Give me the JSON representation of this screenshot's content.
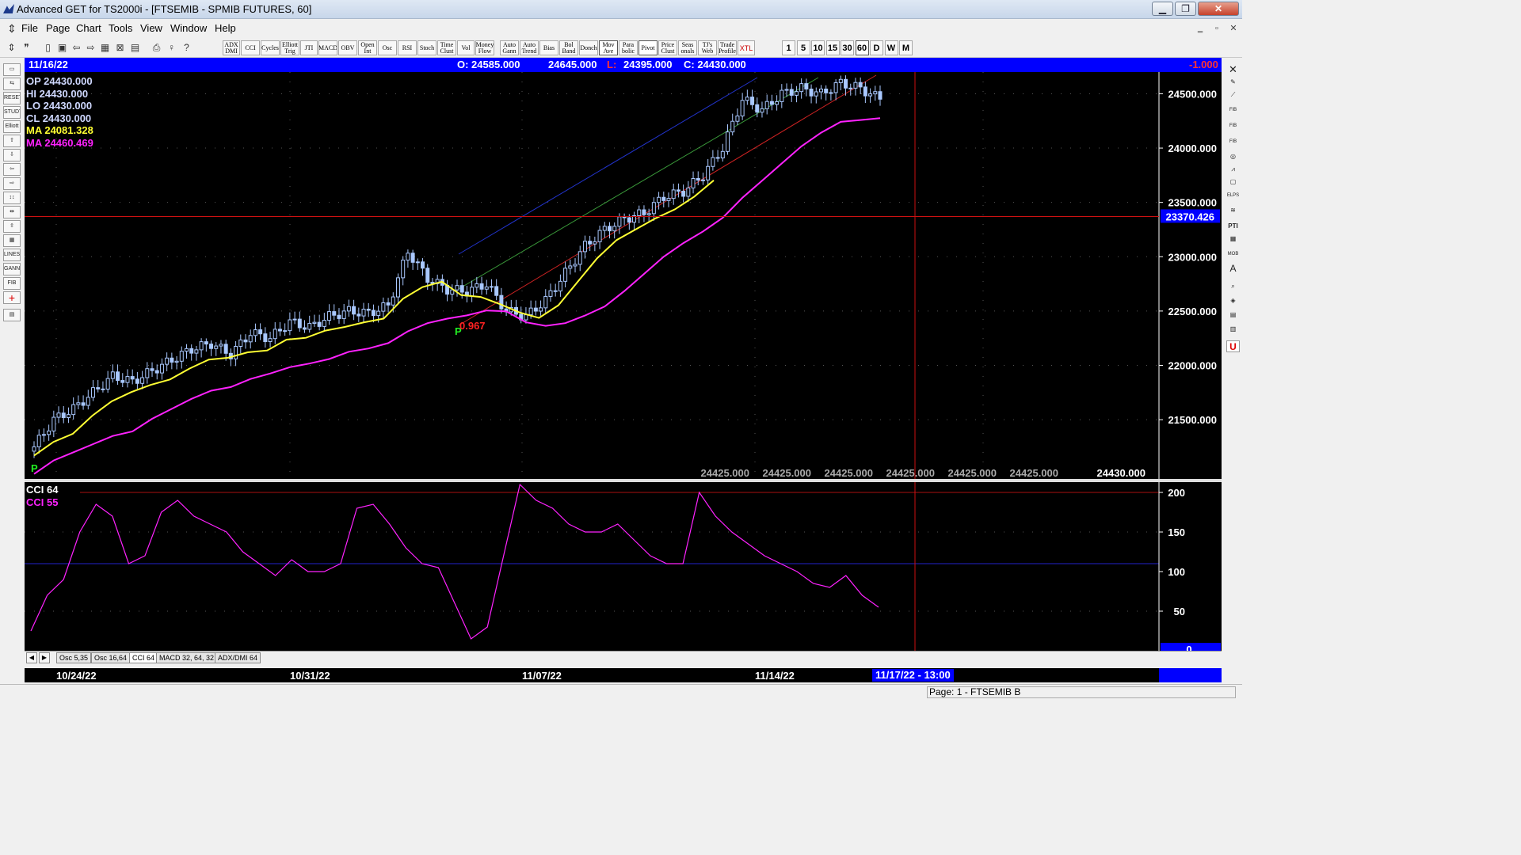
{
  "window": {
    "title": "Advanced GET for TS2000i - [FTSEMIB - SPMIB FUTURES, 60]",
    "controls": {
      "minimize": "▁",
      "maximize": "❐",
      "close": "✕"
    },
    "mdi_controls": {
      "minimize": "‗",
      "restore": "▫",
      "close": "✕"
    }
  },
  "menu": [
    "File",
    "Page",
    "Chart",
    "Tools",
    "View",
    "Window",
    "Help"
  ],
  "toolbar": {
    "studies": [
      "ADX DMI",
      "CCI",
      "Cycles",
      "Elliott Trig",
      "JTI",
      "MACD",
      "OBV",
      "Open Int",
      "Osc",
      "RSI",
      "Stoch",
      "Time Clust",
      "Vol",
      "Money Flow",
      "Auto Gann",
      "Auto Trend",
      "Bias",
      "Bol Band",
      "Donch",
      "Mov Ave",
      "Para bolic",
      "Pivot",
      "Price Clust",
      "Seas onals",
      "TJ's Web",
      "Trade Profile",
      "XTL"
    ],
    "periods": [
      "1",
      "5",
      "10",
      "15",
      "30",
      "60",
      "D",
      "W",
      "M"
    ],
    "selected_period": "60"
  },
  "info_bar": {
    "date": "11/16/22",
    "open": "O: 24585.000",
    "high": "24645.000",
    "low_label": "L:",
    "low": "24395.000",
    "close": "C: 24430.000",
    "change": "-1.000"
  },
  "legend": {
    "op": "OP  24430.000",
    "hi": "HI   24430.000",
    "lo": "LO  24430.000",
    "cl": "CL  24430.000",
    "ma1": "MA  24081.328",
    "ma2": "MA  24460.469"
  },
  "price_axis": [
    "24500.000",
    "24000.000",
    "23500.000",
    "23000.000",
    "22500.000",
    "22000.000",
    "21500.000"
  ],
  "crosshair_price": "23370.426",
  "bottom_prices": [
    "24425.000",
    "24425.000",
    "24425.000",
    "24425.000",
    "24425.000",
    "24425.000",
    "24430.000"
  ],
  "annotations": {
    "pivot_low_1": "P",
    "pivot_low_2": "P",
    "fib_ratio": "0.967"
  },
  "osc": {
    "legend1": "CCI 64",
    "legend2": "CCI  55",
    "axis": [
      "200",
      "150",
      "100",
      "50"
    ],
    "zero_label": "0"
  },
  "tabs": [
    "Osc 5,35",
    "Osc 16,64",
    "CCI 64",
    "MACD 32, 64, 32",
    "ADX/DMI 64"
  ],
  "active_tab": "CCI 64",
  "dates": [
    "10/24/22",
    "10/31/22",
    "11/07/22",
    "11/14/22"
  ],
  "crosshair_date": "11/17/22 - 13:00",
  "status": "Page: 1 - FTSEMIB B",
  "colors": {
    "ma_fast": "#ffff33",
    "ma_slow": "#ff22ff",
    "crosshair": "#cc1111",
    "info_bar": "#0000ff",
    "candles": "#a9c8ff",
    "cci": "#ff22ff"
  },
  "chart_data": [
    {
      "type": "candlestick",
      "title": "FTSEMIB - SPMIB FUTURES, 60",
      "ylim": [
        21100,
        24700
      ],
      "yticks": [
        21500,
        22000,
        22500,
        23000,
        23500,
        24000,
        24500
      ],
      "series": [
        {
          "name": "price",
          "close": [
            21250,
            21500,
            21600,
            21750,
            21900,
            21850,
            21950,
            22050,
            22150,
            22200,
            22100,
            22300,
            22250,
            22400,
            22350,
            22450,
            22500,
            22480,
            22550,
            23050,
            22800,
            22700,
            22680,
            22750,
            22500,
            22450,
            22600,
            22850,
            23100,
            23250,
            23350,
            23400,
            23550,
            23600,
            23750,
            24000,
            24450,
            24350,
            24500,
            24550,
            24500,
            24600,
            24550,
            24450
          ]
        },
        {
          "name": "MA",
          "last": 24081.328
        },
        {
          "name": "MA",
          "last": 24460.469
        }
      ],
      "crosshair": 23370.426
    },
    {
      "type": "line",
      "title": "CCI 64",
      "ylim": [
        0,
        210
      ],
      "yticks": [
        50,
        100,
        150,
        200
      ],
      "series": [
        {
          "name": "CCI 55",
          "values": [
            25,
            70,
            90,
            150,
            185,
            170,
            110,
            120,
            175,
            190,
            170,
            160,
            150,
            125,
            110,
            95,
            115,
            100,
            100,
            110,
            180,
            185,
            160,
            130,
            110,
            105,
            60,
            15,
            30,
            120,
            210,
            190,
            180,
            160,
            150,
            150,
            160,
            140,
            120,
            110,
            110,
            200,
            170,
            150,
            135,
            120,
            110,
            100,
            85,
            80,
            95,
            70,
            55
          ]
        }
      ]
    }
  ]
}
